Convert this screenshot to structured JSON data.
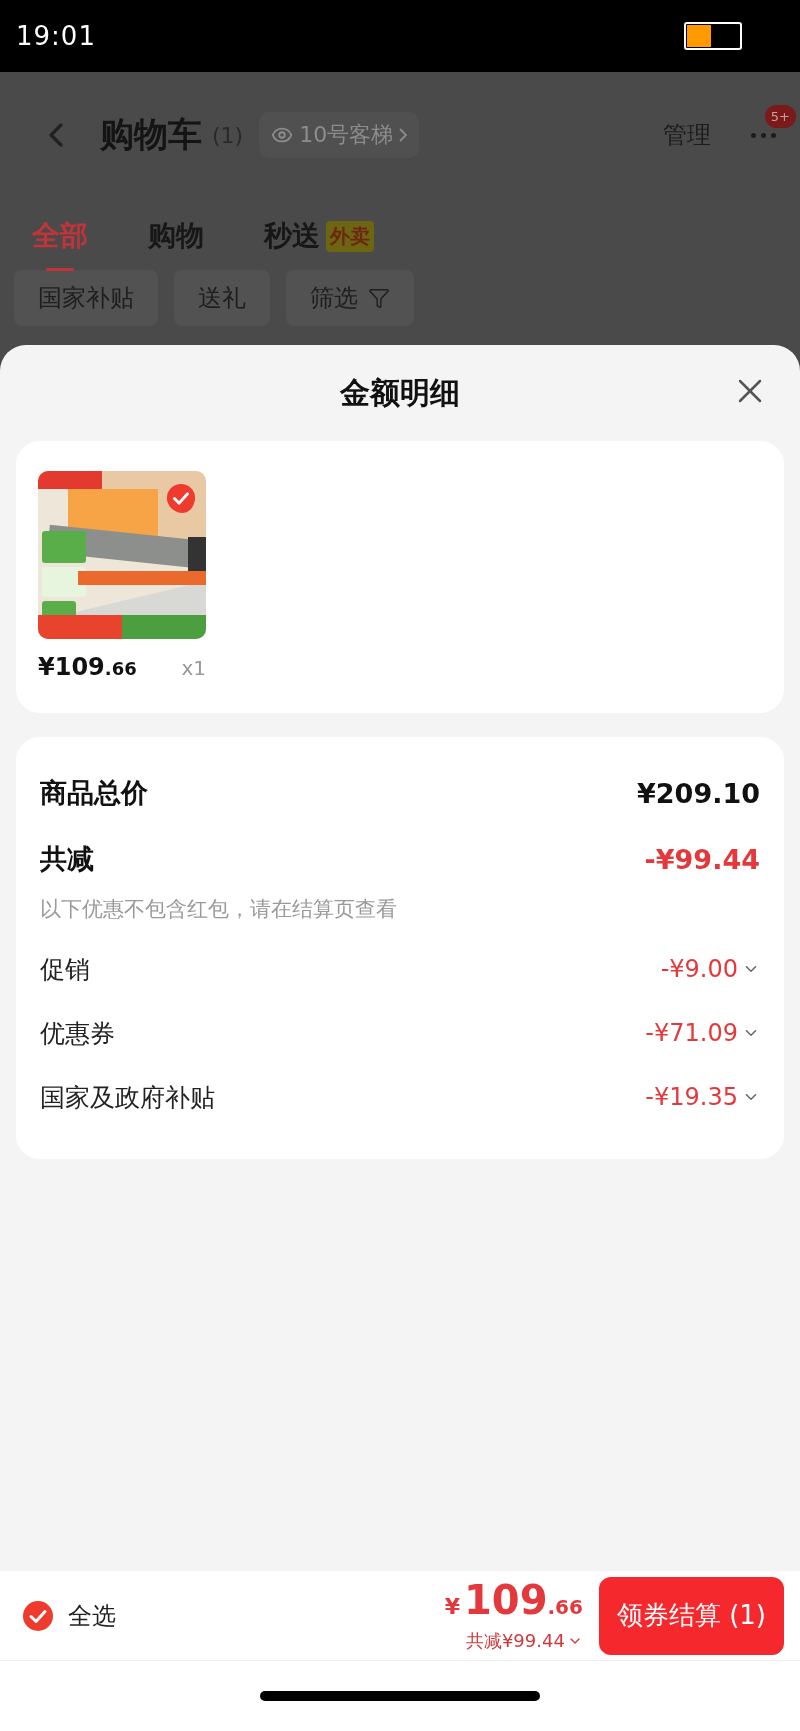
{
  "status_bar": {
    "time": "19:01"
  },
  "header": {
    "title": "购物车",
    "count": "(1)",
    "location": "10号客梯",
    "manage": "管理",
    "more_badge": "5+"
  },
  "tabs": [
    {
      "label": "全部",
      "selected": true
    },
    {
      "label": "购物",
      "selected": false
    },
    {
      "label": "秒送",
      "selected": false,
      "tag": "外卖"
    }
  ],
  "filters": [
    {
      "label": "国家补贴",
      "kind": "plain"
    },
    {
      "label": "送礼",
      "kind": "plain"
    },
    {
      "label": "筛选",
      "kind": "filter"
    }
  ],
  "sheet": {
    "title": "金额明细",
    "items": [
      {
        "kind": "picture",
        "selected": true,
        "price_main": "¥109",
        "price_cents": ".66",
        "quantity": "x1"
      }
    ],
    "summary": {
      "total_label": "商品总价",
      "total": "¥209.10",
      "discount_label": "共减",
      "discount": "-¥99.44",
      "note": "以下优惠不包含红包，请在结算页查看",
      "rows": [
        {
          "label": "促销",
          "value": "-¥9.00"
        },
        {
          "label": "优惠券",
          "value": "-¥71.09"
        },
        {
          "label": "国家及政府补贴",
          "value": "-¥19.35"
        }
      ]
    }
  },
  "footer": {
    "select_all": {
      "label": "全选",
      "checked": true
    },
    "price_symbol": "¥",
    "price_main": "109",
    "price_cents": ".66",
    "discount": "共减¥99.44",
    "checkout": "领券结算 (1)"
  }
}
